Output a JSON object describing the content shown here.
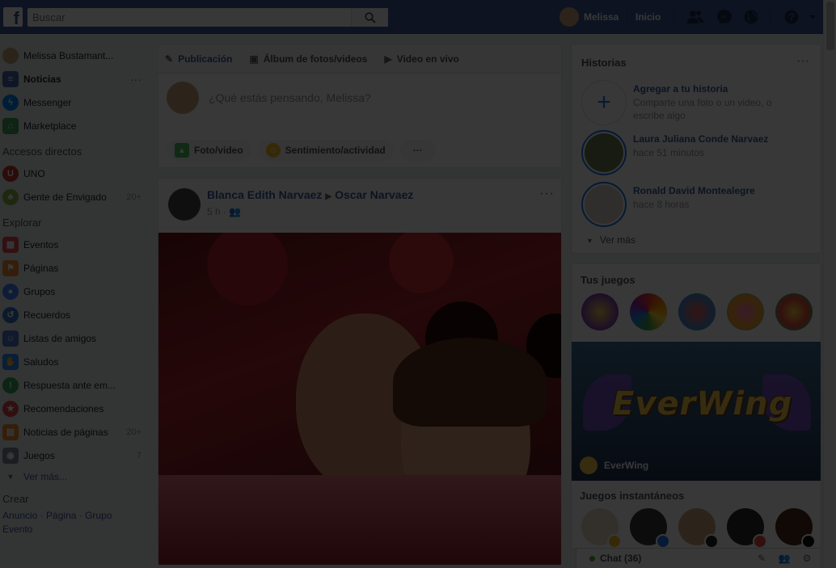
{
  "colors": {
    "brand": "#3b5998",
    "link": "#365899",
    "online": "#42b72a"
  },
  "topbar": {
    "search_placeholder": "Buscar",
    "user_name": "Melissa",
    "home_label": "Inicio",
    "icons": [
      "friend-requests-icon",
      "messenger-icon",
      "notifications-icon",
      "help-icon",
      "account-menu-icon"
    ]
  },
  "left": {
    "profile_name": "Melissa Bustamant...",
    "main_items": [
      {
        "label": "Noticias",
        "icon": "news-feed-icon"
      },
      {
        "label": "Messenger",
        "icon": "messenger-icon"
      },
      {
        "label": "Marketplace",
        "icon": "marketplace-icon"
      }
    ],
    "shortcuts_title": "Accesos directos",
    "shortcuts": [
      {
        "label": "UNO",
        "count": ""
      },
      {
        "label": "Gente de Envigado",
        "count": "20+"
      }
    ],
    "explore_title": "Explorar",
    "explore": [
      {
        "label": "Eventos",
        "count": ""
      },
      {
        "label": "Páginas",
        "count": ""
      },
      {
        "label": "Grupos",
        "count": ""
      },
      {
        "label": "Recuerdos",
        "count": ""
      },
      {
        "label": "Listas de amigos",
        "count": ""
      },
      {
        "label": "Saludos",
        "count": ""
      },
      {
        "label": "Respuesta ante em...",
        "count": ""
      },
      {
        "label": "Recomendaciones",
        "count": ""
      },
      {
        "label": "Noticias de páginas",
        "count": "20+"
      },
      {
        "label": "Juegos",
        "count": "7"
      }
    ],
    "see_more": "Ver más...",
    "create_title": "Crear",
    "create_links": [
      "Anuncio",
      "Página",
      "Grupo",
      "Evento"
    ]
  },
  "composer": {
    "tabs": [
      "Publicación",
      "Álbum de fotos/videos",
      "Video en vivo"
    ],
    "placeholder": "¿Qué estás pensando, Melissa?",
    "actions": [
      "Foto/video",
      "Sentimiento/actividad"
    ],
    "more": "···"
  },
  "post": {
    "author": "Blanca Edith Narvaez",
    "target": "Oscar Narvaez",
    "time": "5 h",
    "more": "···"
  },
  "stories": {
    "title": "Historias",
    "more": "···",
    "add_title": "Agregar a tu historia",
    "add_sub": "Comparte una foto o un video, o escribe algo",
    "items": [
      {
        "name": "Laura Juliana Conde Narvaez",
        "time": "hace 51 minutos"
      },
      {
        "name": "Ronald David Montealegre",
        "time": "hace 8 horas"
      }
    ],
    "see_more": "Ver más"
  },
  "games": {
    "title": "Tus juegos",
    "banner_title": "EverWing",
    "banner_name": "EverWing",
    "instant_title": "Juegos instantáneos"
  },
  "chat": {
    "label": "Chat (36)"
  }
}
